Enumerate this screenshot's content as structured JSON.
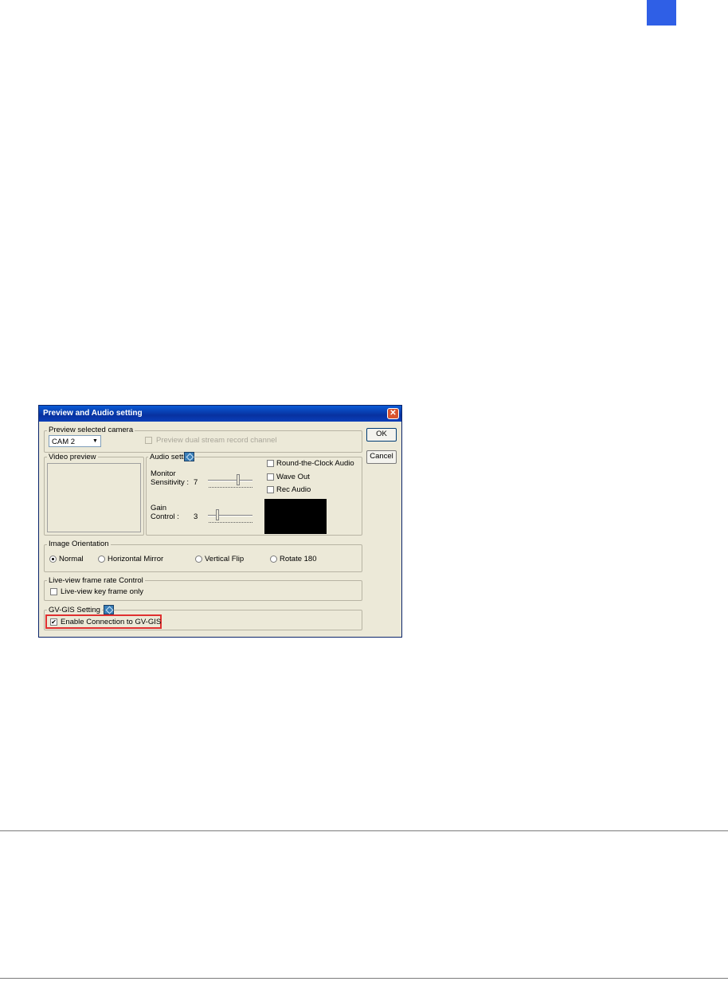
{
  "page": {
    "accent_color": "#2f5fe6"
  },
  "dialog": {
    "title": "Preview and Audio setting",
    "close_label": "✕",
    "buttons": {
      "ok": "OK",
      "cancel": "Cancel"
    },
    "preview_camera": {
      "group_label": "Preview selected camera",
      "camera_selected": "CAM 2",
      "dual_stream_label": "Preview dual stream record channel"
    },
    "video_preview": {
      "group_label": "Video preview"
    },
    "audio": {
      "group_label": "Audio setting",
      "monitor_label_1": "Monitor",
      "monitor_label_2": "Sensitivity :",
      "monitor_value": "7",
      "gain_label_1": "Gain",
      "gain_label_2": "Control :",
      "gain_value": "3",
      "round_clock": "Round-the-Clock Audio",
      "wave_out": "Wave Out",
      "rec_audio": "Rec Audio"
    },
    "orientation": {
      "group_label": "Image Orientation",
      "options": [
        "Normal",
        "Horizontal Mirror",
        "Vertical Flip",
        "Rotate 180"
      ],
      "selected": "Normal"
    },
    "frame_rate": {
      "group_label": "Live-view frame rate Control",
      "key_frame_only": "Live-view key frame only"
    },
    "gis": {
      "group_label": "GV-GIS Setting",
      "enable_label": "Enable Connection to GV-GIS",
      "enabled_mark": "✔"
    }
  }
}
